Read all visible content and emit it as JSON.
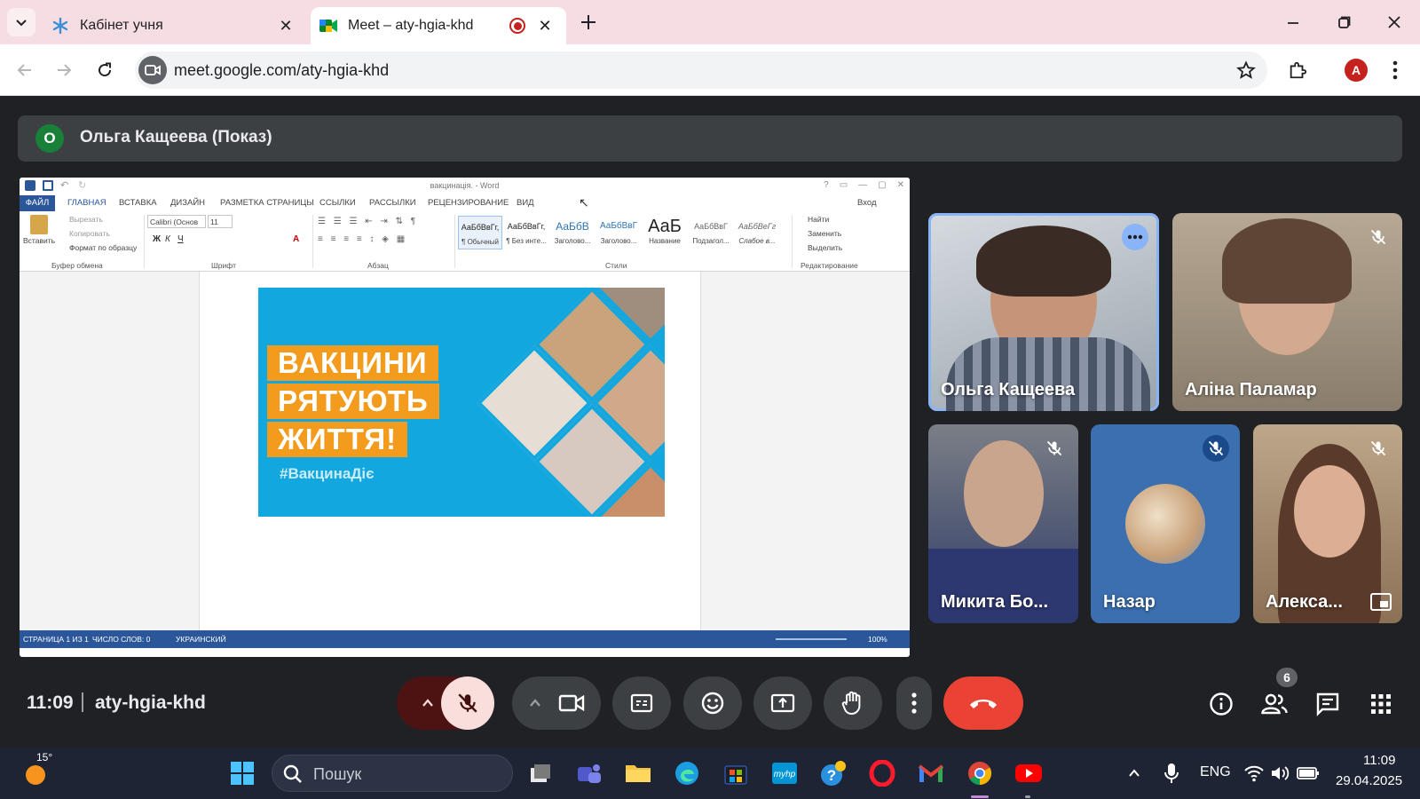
{
  "browser": {
    "tabs": [
      {
        "title": "Кабінет учня"
      },
      {
        "title": "Meet – aty-hgia-khd"
      }
    ],
    "url": "meet.google.com/aty-hgia-khd",
    "profile_initial": "A"
  },
  "meet": {
    "presenter": {
      "avatar_initial": "О",
      "label": "Ольга Кащеева (Показ)"
    },
    "participants": [
      {
        "name": "Ольга Кащеева"
      },
      {
        "name": "Аліна Паламар"
      },
      {
        "name": "Микита Бо..."
      },
      {
        "name": "Назар"
      },
      {
        "name": "Алекса..."
      }
    ],
    "clock": "11:09",
    "meeting_code": "aty-hgia-khd",
    "people_count": "6"
  },
  "word": {
    "doc_title": "вакцинація. - Word",
    "tabs": {
      "file": "ФАЙЛ",
      "home": "ГЛАВНАЯ",
      "insert": "ВСТАВКА",
      "design": "ДИЗАЙН",
      "layout": "РАЗМЕТКА СТРАНИЦЫ",
      "references": "ССЫЛКИ",
      "mailings": "РАССЫЛКИ",
      "review": "РЕЦЕНЗИРОВАНИЕ",
      "view": "ВИД",
      "signin": "Вход"
    },
    "ribbon": {
      "paste": "Вставить",
      "cut": "Вырезать",
      "copy": "Копировать",
      "format_painter": "Формат по образцу",
      "font_name": "Calibri (Основ",
      "font_size": "11",
      "find": "Найти",
      "replace": "Заменить",
      "select": "Выделить",
      "groups": {
        "clipboard": "Буфер обмена",
        "font": "Шрифт",
        "paragraph": "Абзац",
        "styles": "Стили",
        "editing": "Редактирование"
      },
      "styles": [
        {
          "sample": "АаБбВвГг,",
          "name": "¶ Обычный"
        },
        {
          "sample": "АаБбВвГг,",
          "name": "¶ Без инте..."
        },
        {
          "sample": "АаБбВ",
          "name": "Заголово..."
        },
        {
          "sample": "АаБбВвГ",
          "name": "Заголово..."
        },
        {
          "sample": "АаБ",
          "name": "Название"
        },
        {
          "sample": "АаБбВвГ",
          "name": "Подзагол..."
        },
        {
          "sample": "АаБбВеГг",
          "name": "Слабое в..."
        }
      ]
    },
    "poster": {
      "line1": "ВАКЦИНИ",
      "line2": "РЯТУЮТЬ",
      "line3": "ЖИТТЯ!",
      "hashtag": "#ВакцинаДіє"
    },
    "status": {
      "page": "СТРАНИЦА 1 ИЗ 1",
      "words": "ЧИСЛО СЛОВ: 0",
      "lang": "УКРАИНСКИЙ",
      "zoom": "100%"
    }
  },
  "taskbar": {
    "weather_temp": "15°",
    "search_placeholder": "Пошук",
    "lang": "ENG",
    "time": "11:09",
    "date": "29.04.2025"
  },
  "colors": {
    "meet_bg": "#202124",
    "end_call": "#ea4335",
    "word_blue": "#2b579a",
    "poster_orange": "#f29b1d",
    "poster_blue": "#12a7de"
  }
}
